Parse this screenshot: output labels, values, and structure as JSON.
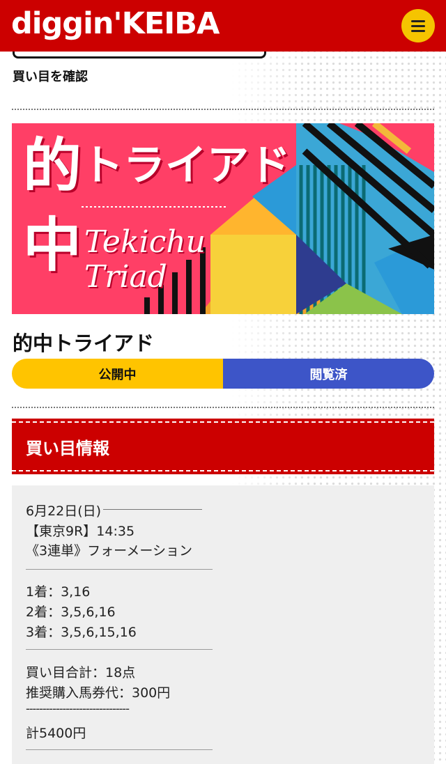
{
  "header": {
    "logo": "diggin'KEIBA",
    "menu_icon": "hamburger-icon",
    "brand_color": "#cc0000",
    "accent_color": "#f5c400"
  },
  "confirm_link": "買い目を確認",
  "banner": {
    "jp_title_a": "的",
    "jp_title_b": "中",
    "jp_title_katakana": "トライアド",
    "en_line1": "Tekichu",
    "en_line2": "Triad"
  },
  "article": {
    "title": "的中トライアド",
    "status_open": "公開中",
    "status_viewed": "閲覧済"
  },
  "section": {
    "heading": "買い目情報"
  },
  "bet_info": {
    "date": "6月22日(日)",
    "race": "【東京9R】14:35",
    "bet_type": "《3連単》フォーメーション",
    "first": "1着：3,16",
    "second": "2着：3,5,6,16",
    "third": "3着：3,5,6,15,16",
    "total_points": "買い目合計：18点",
    "price_per_ticket": "推奨購入馬券代：300円",
    "separator": "-------------------------------",
    "total": "計5400円"
  }
}
